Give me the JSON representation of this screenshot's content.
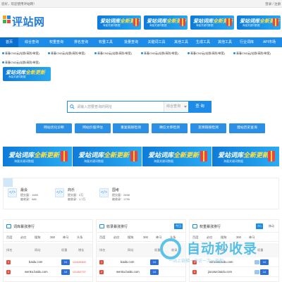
{
  "topbar": {
    "welcome": "您好，欢迎使用评站网！",
    "auth": "登录 / 注册"
  },
  "logo": {
    "title": "评站网",
    "subtitle": "PINGZHAN NETWORK"
  },
  "banner": {
    "text_a": "爱站词库",
    "text_b": "全新更新",
    "sub": "海量关键词数据"
  },
  "nav": {
    "items": [
      "首页",
      "综合查询",
      "权重查询",
      "排名查询",
      "权重工具",
      "批量查询",
      "关键词工具",
      "其他工具",
      "生成工具",
      "其他工具",
      "行业词库",
      "API市场"
    ],
    "active_index": 0
  },
  "tickers": {
    "row1": [
      "青春CN2云(站群/高防/带宽)",
      "青春CN2云(站群/高防/带宽)",
      "青春CN2云(站群/高防/带宽)",
      "青春CN2云(站群/高防/带宽)",
      "青春CN2云(站群/高防/带宽)",
      "青春CN2云(站群/高防/带宽)"
    ],
    "row2": [
      "青春CN2云(站群/高防/带宽)"
    ]
  },
  "search": {
    "placeholder": "请输入您要查询的网址",
    "select_value": "综合查询",
    "button": "查 询"
  },
  "quick_buttons": [
    "网站优化诊断",
    "网站价值评估",
    "重复链接检测",
    "微信文章检测",
    "友情链接检测",
    "建站历史查询"
  ],
  "stats": [
    {
      "icon": "</>",
      "name": "最会",
      "l1": "提交量：1569",
      "l2": "被收录：986"
    },
    {
      "icon": "</>",
      "name": "商乐",
      "l1": "提交量：2万",
      "l2": "被收录：1.7万"
    },
    {
      "icon": "</>",
      "name": "国考",
      "l1": "提交量：2698",
      "l2": "被收录：1795"
    }
  ],
  "panels": [
    {
      "title": "词库暴涨排行",
      "tag": "",
      "tabs": [
        "百度",
        "必应",
        "搜狗",
        "360",
        "神马",
        "头条"
      ],
      "cols": [
        "排名",
        "网站",
        "权重",
        "增长"
      ],
      "rows": [
        {
          "num": "1",
          "site": "baidu.com",
          "weight": "10",
          "growth": "↑22649360"
        },
        {
          "num": "2",
          "site": "wenku.baidu.com",
          "weight": "10",
          "growth": "↑22452737"
        }
      ]
    },
    {
      "title": "收录暴涨排行",
      "tag": "今日",
      "tabs": [
        "百度",
        "必应",
        "搜狗",
        "360",
        "神马",
        "头条"
      ],
      "cols": [
        "排名",
        "网站",
        "权重",
        "收录"
      ],
      "rows": [
        {
          "num": "1",
          "site": "baidu.com",
          "weight": "10",
          "growth": ""
        },
        {
          "num": "2",
          "site": "wenku.baidu.com",
          "weight": "10",
          "growth": ""
        }
      ]
    },
    {
      "title": "权重暴涨排行",
      "tag": "PC",
      "tag2": "移动",
      "tabs": [
        "百度",
        "必应",
        "搜狗",
        "360",
        "神马"
      ],
      "cols": [
        "排名",
        "网站",
        "权重"
      ],
      "rows": [
        {
          "num": "1",
          "site": "wmxiaobaidu.com",
          "weight": "10",
          "growth": ""
        },
        {
          "num": "2",
          "site": "jiocaiwi.baidu.com",
          "weight": "10",
          "growth": ""
        }
      ]
    }
  ],
  "watermark": {
    "title": "自动秒收录",
    "sub": "一站上链梯一来访一次一曾加"
  },
  "colors": {
    "primary": "#1d8be8",
    "dark": "#0a6ed0",
    "accent": "#ffe14a",
    "danger": "#e74c3c"
  }
}
